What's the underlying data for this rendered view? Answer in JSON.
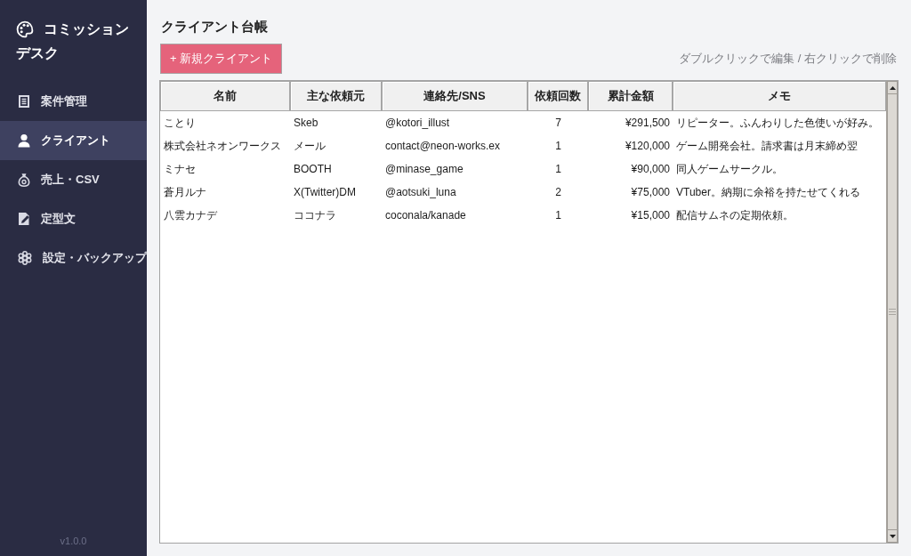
{
  "sidebar": {
    "title_lines": [
      "コミッション",
      "デスク"
    ],
    "nav": [
      {
        "label": "案件管理",
        "selected": false
      },
      {
        "label": "クライアント",
        "selected": true
      },
      {
        "label": "売上・CSV",
        "selected": false
      },
      {
        "label": "定型文",
        "selected": false
      },
      {
        "label": "設定・バックアップ",
        "selected": false
      }
    ],
    "version": "v1.0.0"
  },
  "main": {
    "title": "クライアント台帳",
    "new_button": "+ 新規クライアント",
    "hint": "ダブルクリックで編集 / 右クリックで削除",
    "table": {
      "columns": [
        "名前",
        "主な依頼元",
        "連絡先/SNS",
        "依頼回数",
        "累計金額",
        "メモ"
      ],
      "rows": [
        [
          "ことり",
          "Skeb",
          "@kotori_illust",
          "7",
          "¥291,500",
          "リピーター。ふんわりした色使いが好み。"
        ],
        [
          "株式会社ネオンワークス",
          "メール",
          "contact@neon-works.ex",
          "1",
          "¥120,000",
          "ゲーム開発会社。請求書は月末締め翌"
        ],
        [
          "ミナセ",
          "BOOTH",
          "@minase_game",
          "1",
          "¥90,000",
          "同人ゲームサークル。"
        ],
        [
          "蒼月ルナ",
          "X(Twitter)DM",
          "@aotsuki_luna",
          "2",
          "¥75,000",
          "VTuber。納期に余裕を持たせてくれる"
        ],
        [
          "八雲カナデ",
          "ココナラ",
          "coconala/kanade",
          "1",
          "¥15,000",
          "配信サムネの定期依頼。"
        ]
      ]
    }
  }
}
